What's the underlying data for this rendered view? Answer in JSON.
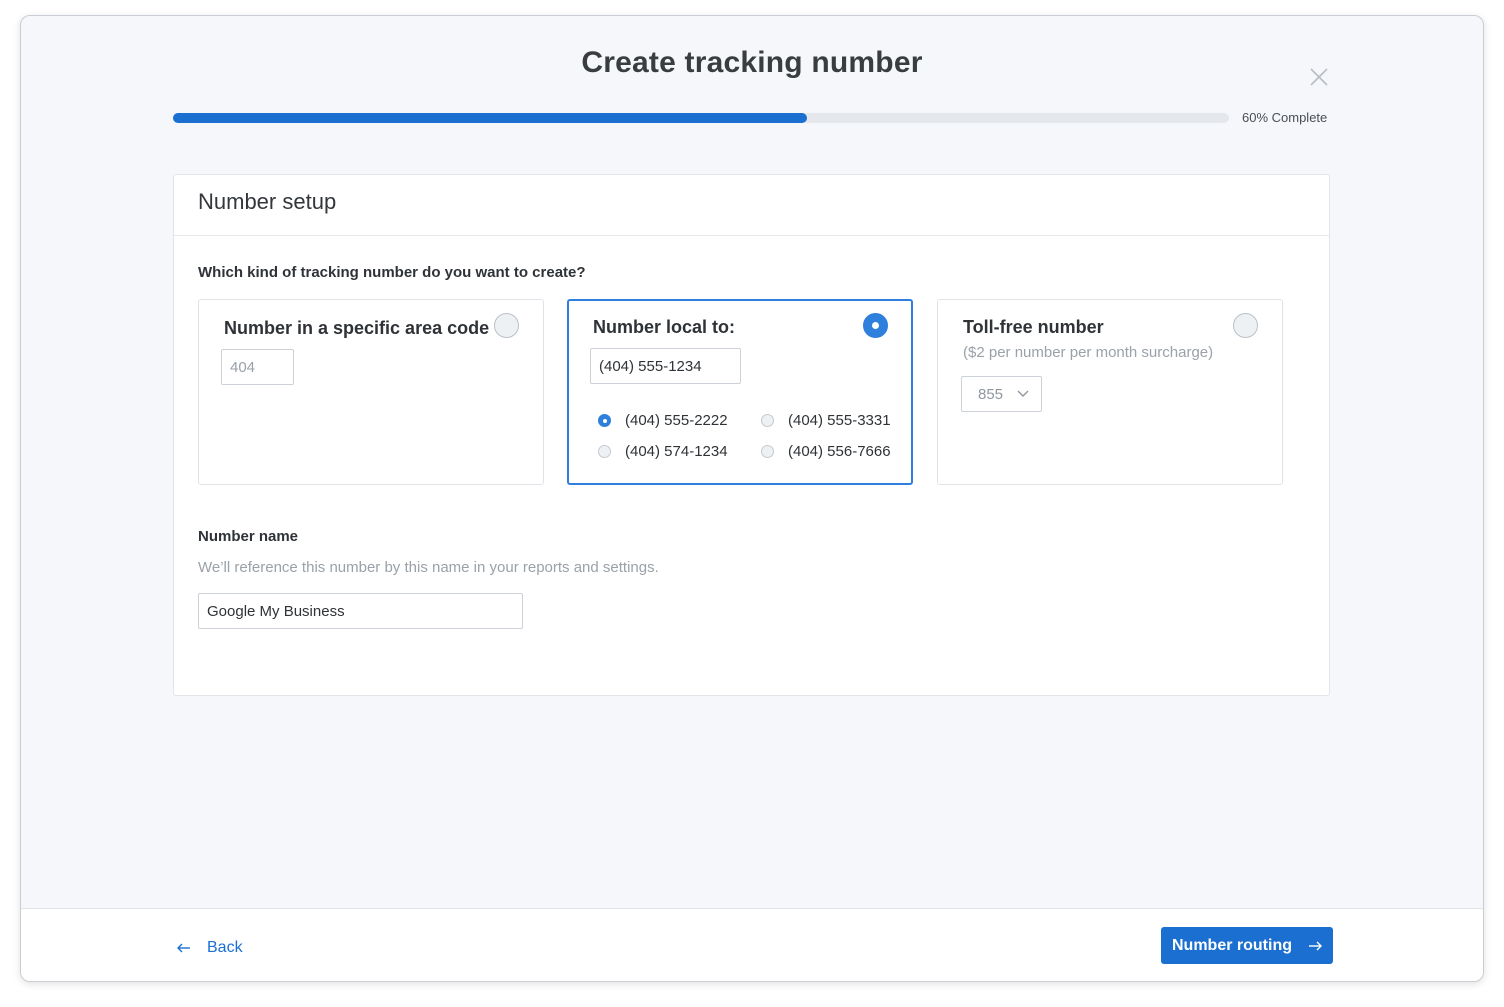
{
  "header": {
    "title": "Create tracking number",
    "progress": 0.6,
    "progress_label": "60% Complete"
  },
  "panel": {
    "title": "Number setup",
    "question": "Which kind of tracking number do you want to create?",
    "options": [
      {
        "title": "Number in a specific area code",
        "selected": false,
        "area_code_placeholder": "404"
      },
      {
        "title": "Number local to:",
        "selected": true,
        "local_value": "(404) 555-1234",
        "choices": [
          {
            "number": "(404) 555-2222",
            "selected": true
          },
          {
            "number": "(404) 555-3331",
            "selected": false
          },
          {
            "number": "(404) 574-1234",
            "selected": false
          },
          {
            "number": "(404) 556-7666",
            "selected": false
          }
        ]
      },
      {
        "title": "Toll-free number",
        "subtitle": "($2 per number per month surcharge)",
        "selected": false,
        "prefix_value": "855"
      }
    ],
    "name_field": {
      "label": "Number name",
      "hint": "We’ll reference this number by this name in your reports and settings.",
      "value": "Google My Business"
    }
  },
  "footer": {
    "back_label": "Back",
    "next_label": "Number routing"
  },
  "colors": {
    "accent": "#1a6fd1",
    "selected_border": "#2f7fdc"
  }
}
